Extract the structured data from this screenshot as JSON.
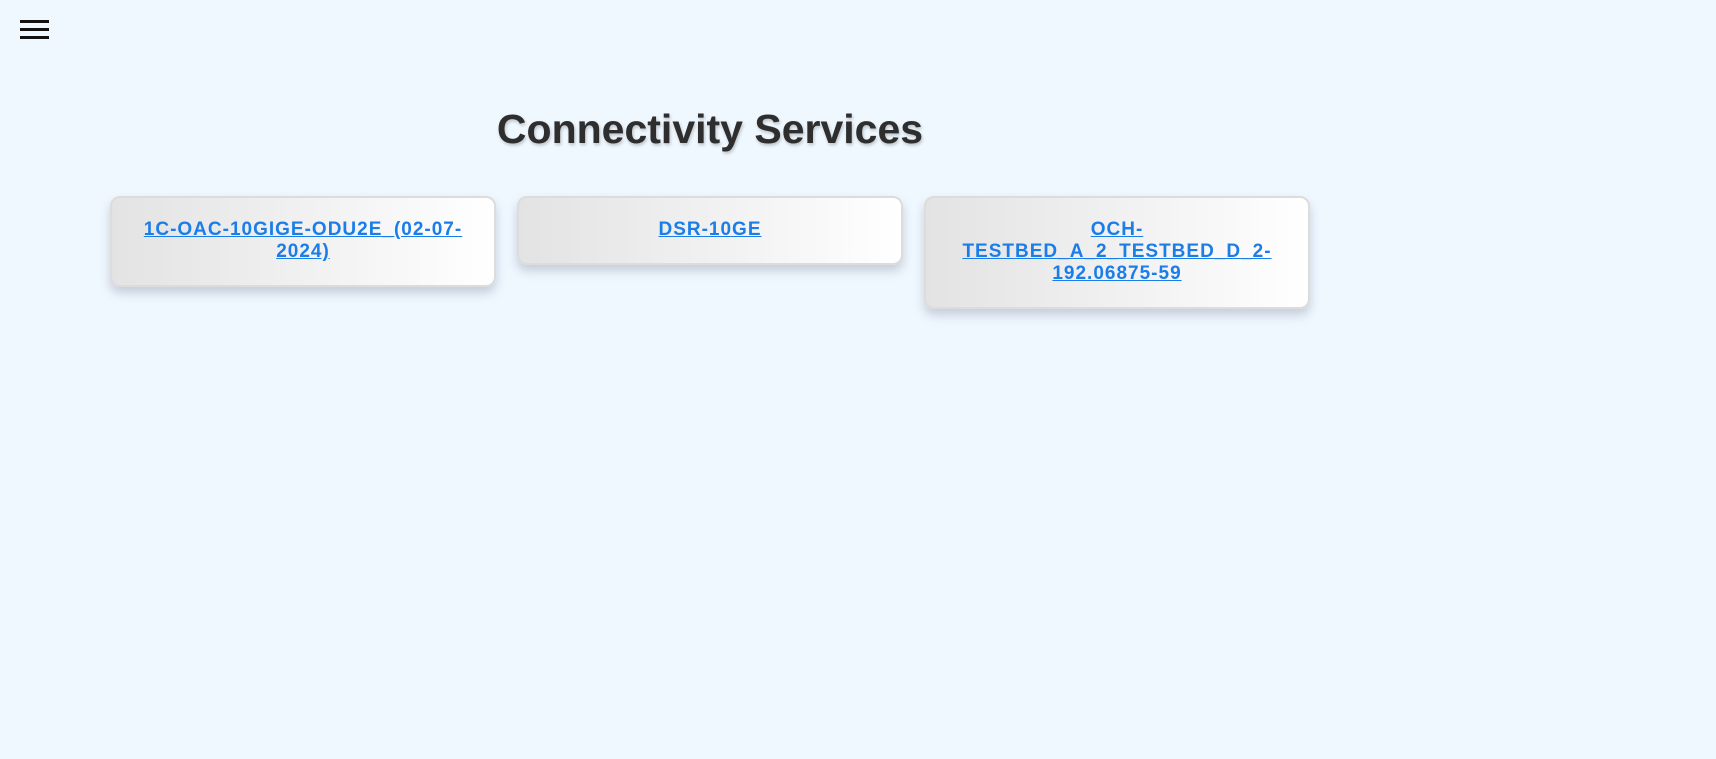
{
  "header": {
    "menu_icon": "hamburger-menu-icon"
  },
  "page": {
    "title": "Connectivity Services"
  },
  "services": [
    {
      "label": "1C-OAC-10GIGE-ODU2E_(02-07-2024)"
    },
    {
      "label": "DSR-10GE"
    },
    {
      "label": "OCH-TESTBED_A_2_TESTBED_D_2-192.06875-59"
    }
  ],
  "colors": {
    "background": "#eff7ff",
    "link": "#1a7de8",
    "title": "#2e2e2e"
  }
}
